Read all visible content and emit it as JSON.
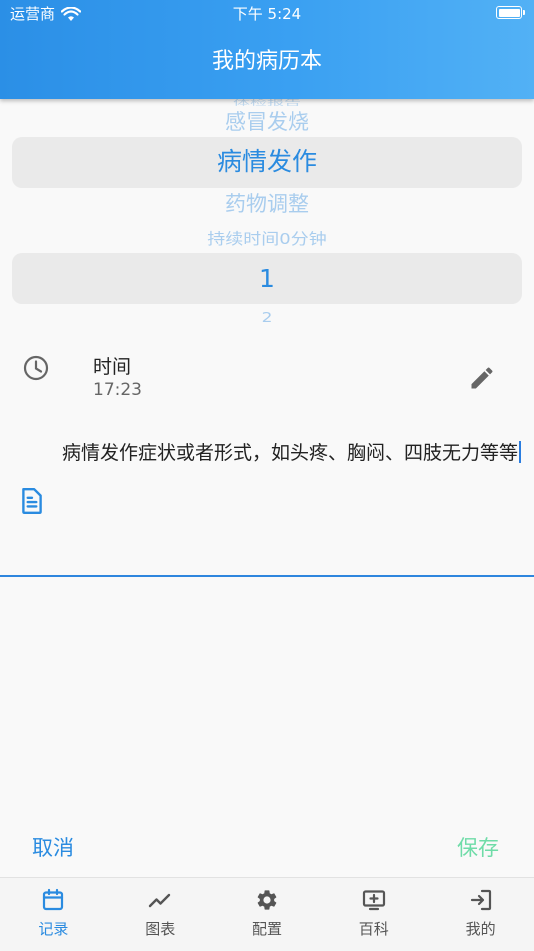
{
  "status_bar": {
    "carrier": "运营商",
    "time": "下午 5:24"
  },
  "header": {
    "title": "我的病历本"
  },
  "picker_type": {
    "partial_above": "体检报告",
    "above": "感冒发烧",
    "selected": "病情发作",
    "below": "药物调整",
    "partial_below": "持续时间0分钟"
  },
  "picker_count": {
    "selected": "1",
    "below": "2"
  },
  "time_row": {
    "label": "时间",
    "value": "17:23",
    "icon": "clock-icon",
    "action_icon": "edit-icon"
  },
  "note": {
    "value": "病情发作症状或者形式，如头疼、胸闷、四肢无力等等",
    "icon": "document-icon",
    "accent": "#2e86de"
  },
  "actions": {
    "cancel": "取消",
    "save": "保存"
  },
  "tabs": [
    {
      "label": "记录",
      "icon": "calendar-icon",
      "active": true
    },
    {
      "label": "图表",
      "icon": "trend-chart-icon",
      "active": false
    },
    {
      "label": "配置",
      "icon": "gear-icon",
      "active": false
    },
    {
      "label": "百科",
      "icon": "add-screen-icon",
      "active": false
    },
    {
      "label": "我的",
      "icon": "login-icon",
      "active": false
    }
  ],
  "colors": {
    "primary": "#2a8be0",
    "save": "#6fdca8",
    "header_start": "#2b8fe6",
    "header_end": "#52b1f5"
  }
}
